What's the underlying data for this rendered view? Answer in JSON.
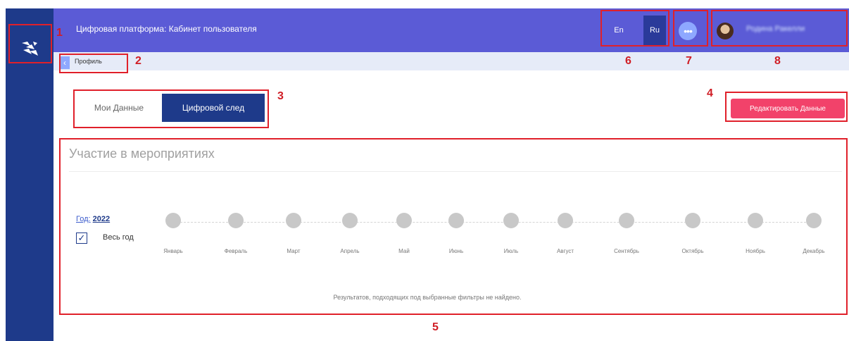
{
  "header": {
    "title": "Цифровая платформа: Кабинет пользователя",
    "lang_en": "En",
    "lang_ru": "Ru",
    "menu_glyph": "•••",
    "user_name": "Родина Ракелли"
  },
  "breadcrumb": {
    "back_glyph": "‹",
    "label": "Профиль"
  },
  "tabs": {
    "my_data": "Мои Данные",
    "digital_trace": "Цифровой след"
  },
  "actions": {
    "edit": "Редактировать Данные"
  },
  "panel": {
    "title": "Участие в мероприятиях",
    "year_key": "Год:",
    "year_value": "2022",
    "whole_year_checked": true,
    "check_glyph": "✓",
    "whole_year_label": "Весь год",
    "months": [
      "Январь",
      "Февраль",
      "Март",
      "Апрель",
      "Май",
      "Июнь",
      "Июль",
      "Август",
      "Сентябрь",
      "Октябрь",
      "Ноябрь",
      "Декабрь"
    ],
    "no_results": "Результатов, подходящих под выбранные фильтры не найдено."
  },
  "annotations": [
    "1",
    "2",
    "3",
    "4",
    "5",
    "6",
    "7",
    "8"
  ],
  "colors": {
    "sidebar": "#1e3a8a",
    "topbar": "#5b5bd6",
    "active_tab": "#1e3a8a",
    "edit_button": "#f2426a",
    "annotation": "#e0202a"
  }
}
